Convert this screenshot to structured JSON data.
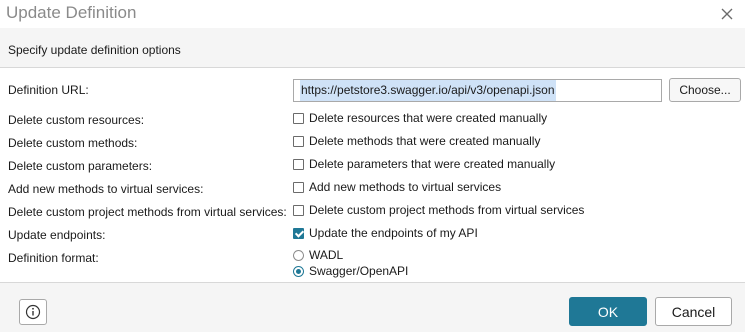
{
  "dialog": {
    "title": "Update Definition",
    "banner": "Specify update definition options"
  },
  "fields": {
    "definition_url_label": "Definition URL:",
    "definition_url_value": "https://petstore3.swagger.io/api/v3/openapi.json",
    "choose_label": "Choose...",
    "delete_resources_label": "Delete custom resources:",
    "delete_resources_option": "Delete resources that were created manually",
    "delete_resources_checked": false,
    "delete_methods_label": "Delete custom methods:",
    "delete_methods_option": "Delete methods that were created manually",
    "delete_methods_checked": false,
    "delete_parameters_label": "Delete custom parameters:",
    "delete_parameters_option": "Delete parameters that were created manually",
    "delete_parameters_checked": false,
    "add_methods_label": "Add new methods to virtual services:",
    "add_methods_option": "Add new methods to virtual services",
    "add_methods_checked": false,
    "delete_project_methods_label": "Delete custom project methods from virtual services:",
    "delete_project_methods_option": "Delete custom project methods from virtual services",
    "delete_project_methods_checked": false,
    "update_endpoints_label": "Update endpoints:",
    "update_endpoints_option": "Update the endpoints of my API",
    "update_endpoints_checked": true,
    "definition_format_label": "Definition format:",
    "format_options": [
      "WADL",
      "Swagger/OpenAPI"
    ],
    "format_selected": "Swagger/OpenAPI"
  },
  "footer": {
    "ok_label": "OK",
    "cancel_label": "Cancel"
  },
  "colors": {
    "accent": "#1f7896",
    "banner_bg": "#f5f5f5",
    "title_text": "#8a8a8a"
  },
  "icons": {
    "close": "close-icon",
    "info": "info-icon"
  }
}
